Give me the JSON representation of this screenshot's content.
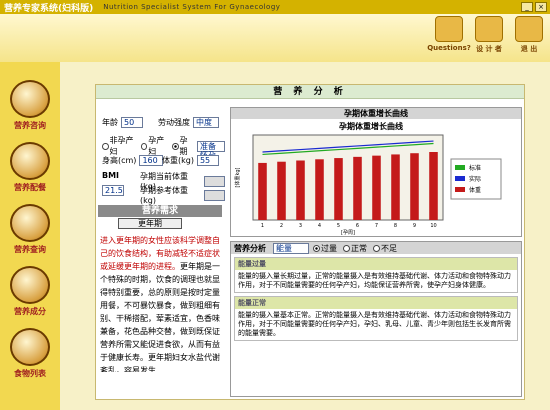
{
  "titlebar": {
    "app": "营养专家系统(妇科版)",
    "subtitle": "Nutrition Specialist System For Gynaecology"
  },
  "topicons": [
    {
      "label": "Questions?"
    },
    {
      "label": "设 计 者"
    },
    {
      "label": "退 出"
    }
  ],
  "sidebar": [
    "营养咨询",
    "营养配餐",
    "营养查询",
    "营养成分",
    "食物列表"
  ],
  "panel": {
    "title": "营 养 分 析"
  },
  "form": {
    "age_label": "年龄",
    "age": "50",
    "labor_label": "劳动强度",
    "labor": "中度",
    "pregnancy_options": [
      "非孕产妇",
      "孕产妇",
      "孕期"
    ],
    "pregnancy_value": "准备怀孕",
    "height_label": "身高(cm)",
    "height": "160",
    "weight_label": "体重(kg)",
    "weight": "55",
    "bmi_label": "BMI",
    "bmi": "21.5",
    "cur_weight_label": "孕期当前体重(kg)",
    "ref_weight_label": "孕期参考体重(kg)"
  },
  "requirement": {
    "title": "营养需求",
    "button": "更年期",
    "text_red": "进入更年期的女性应该科学调整自己的饮食结构，有助减轻不适症状或延缓更年期的进程。",
    "text": "更年期是一个特殊的时期，饮食的调理也就显得特别重要，总的原则是按时定量用餐，不可暴饮暴食，做到粗细有别、干稀搭配，荤素适宜，色香味兼备，花色品种交替，做到既保证营养所需又能促进食欲，从而有益于健康长寿。更年期妇女水盐代谢紊乱，容易发生"
  },
  "chart": {
    "header": "孕期体重增长曲线",
    "title": "孕期体重增长曲线",
    "xlabel": "[孕周]",
    "ylabel": "[体重kg]",
    "legend": [
      "标准",
      "实际",
      "体重"
    ]
  },
  "chart_data": {
    "type": "bar",
    "categories": [
      "1",
      "2",
      "3",
      "4",
      "5",
      "6",
      "7",
      "8",
      "9",
      "10"
    ],
    "series": [
      {
        "name": "体重",
        "values": [
          47,
          48,
          49,
          50,
          51,
          52,
          53,
          54,
          55,
          56
        ]
      },
      {
        "name": "标准",
        "values": [
          54,
          55,
          56,
          57,
          58,
          59,
          60,
          61,
          62,
          63
        ]
      },
      {
        "name": "实际",
        "values": [
          56,
          57,
          58,
          59,
          60,
          61,
          62,
          63,
          64,
          65
        ]
      }
    ],
    "ylim": [
      0,
      70
    ]
  },
  "analysis": {
    "label": "营养分析",
    "select": "能量",
    "radios": [
      "过量",
      "正常",
      "不足"
    ],
    "sections": [
      {
        "title": "能量过量",
        "body": "能量的摄入量长期过量，正常的能量摄入是有效维持基础代谢、体力活动和食物特殊动力作用，对于不同能量需要的任何孕产妇，均能保证营养所需，使孕产妇身体健康。"
      },
      {
        "title": "能量正常",
        "body": "能量的摄入量基本正常。正常的能量摄入是有效维持基础代谢、体力活动和食物特殊动力作用，对于不同能量需要的任何孕产妇，孕妇、乳母、儿童、青少年则包括生长发育所需的能量需要。"
      }
    ]
  }
}
